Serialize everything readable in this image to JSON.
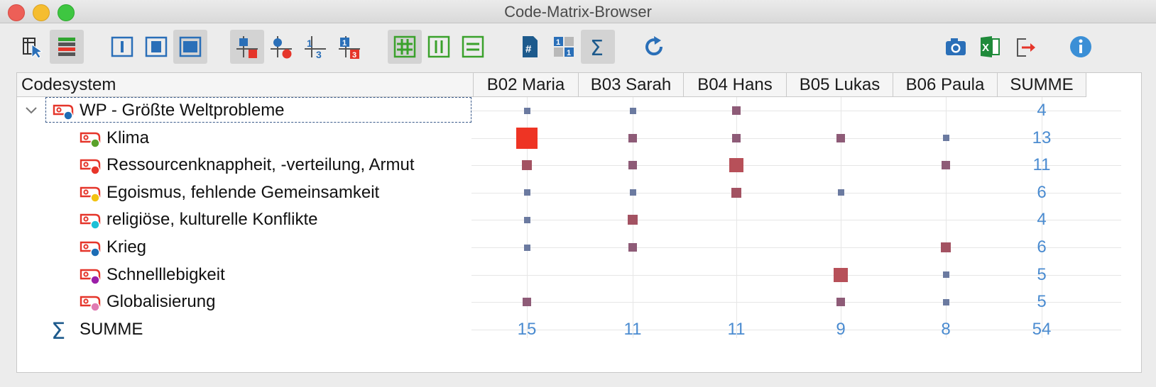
{
  "window": {
    "title": "Code-Matrix-Browser"
  },
  "toolbar": {
    "icons": [
      "select-cursor-icon",
      "codes-color-icon",
      "view-narrow-icon",
      "view-medium-icon",
      "view-wide-icon",
      "symbols-squares-icon",
      "symbols-circles-icon",
      "symbols-numbers-icon",
      "symbols-number-squares-icon",
      "grid-both-icon",
      "grid-columns-icon",
      "grid-rows-icon",
      "document-hash-icon",
      "binary-icon",
      "sum-icon",
      "refresh-icon",
      "camera-icon",
      "excel-icon",
      "export-icon",
      "info-icon"
    ]
  },
  "table": {
    "code_header": "Codesystem",
    "columns": [
      "B02 Maria",
      "B03 Sarah",
      "B04 Hans",
      "B05 Lukas",
      "B06 Paula",
      "SUMME"
    ],
    "parent": {
      "label": "WP - Größte Weltprobleme",
      "color": "#1d6db5",
      "values": [
        1,
        1,
        2,
        0,
        0
      ],
      "sum": "4"
    },
    "rows": [
      {
        "label": "Klima",
        "color": "#5aa12b",
        "values": [
          8,
          2,
          2,
          2,
          1
        ],
        "sum": "13"
      },
      {
        "label": "Ressourcenknappheit, -verteilung, Armut",
        "color": "#e8352a",
        "values": [
          3,
          2,
          4,
          0,
          2
        ],
        "sum": "11"
      },
      {
        "label": "Egoismus, fehlende Gemeinsamkeit",
        "color": "#f2c312",
        "values": [
          1,
          1,
          3,
          1,
          0
        ],
        "sum": "6"
      },
      {
        "label": "religiöse, kulturelle Konflikte",
        "color": "#1ec0d6",
        "values": [
          1,
          3,
          0,
          0,
          0
        ],
        "sum": "4"
      },
      {
        "label": "Krieg",
        "color": "#1d6db5",
        "values": [
          1,
          2,
          0,
          0,
          3
        ],
        "sum": "6"
      },
      {
        "label": "Schnelllebigkeit",
        "color": "#9b1fa8",
        "values": [
          0,
          0,
          0,
          4,
          1
        ],
        "sum": "5"
      },
      {
        "label": "Globalisierung",
        "color": "#e07bb2",
        "values": [
          2,
          0,
          0,
          2,
          1
        ],
        "sum": "5"
      }
    ],
    "sum_row": {
      "label": "SUMME",
      "values": [
        "15",
        "11",
        "11",
        "9",
        "8"
      ],
      "total": "54"
    }
  }
}
